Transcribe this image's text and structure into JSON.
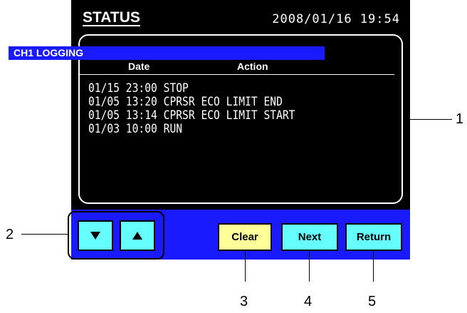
{
  "header": {
    "title": "STATUS",
    "datetime": "2008/01/16  19:54"
  },
  "log_panel": {
    "title": "CH1 LOGGING",
    "columns": [
      "Date",
      "Action"
    ],
    "rows": [
      {
        "date": "01/15 23:00",
        "action": "STOP"
      },
      {
        "date": "01/05 13:20",
        "action": "CPRSR ECO LIMIT END"
      },
      {
        "date": "01/05 13:14",
        "action": "CPRSR ECO LIMIT START"
      },
      {
        "date": "01/03 10:00",
        "action": "RUN"
      }
    ]
  },
  "buttons": {
    "clear": "Clear",
    "next": "Next",
    "return": "Return"
  },
  "icons": {
    "down": "arrow-down-icon",
    "up": "arrow-up-icon"
  },
  "callouts": [
    "1",
    "2",
    "3",
    "4",
    "5"
  ],
  "colors": {
    "screen_bg": "#000000",
    "bar_bg": "#1a1aff",
    "button_cyan": "#66ffff",
    "button_yellow": "#ffff99"
  }
}
